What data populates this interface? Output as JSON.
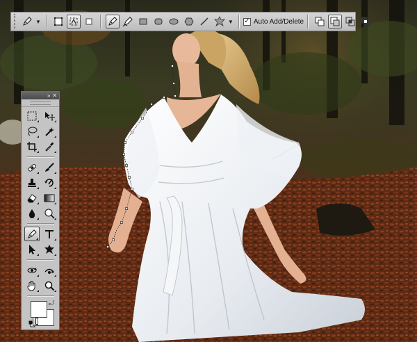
{
  "app": "Photoshop",
  "options_bar": {
    "tool_preset_icon": "pen-preset-icon",
    "mode_buttons": [
      "shape-layers-icon",
      "paths-icon",
      "fill-pixels-icon"
    ],
    "active_mode": "paths",
    "draw_tools": [
      "pen-icon",
      "freeform-pen-icon",
      "rectangle-icon",
      "rounded-rectangle-icon",
      "ellipse-icon",
      "polygon-icon",
      "line-icon",
      "custom-shape-icon"
    ],
    "active_draw_tool": "pen",
    "auto_add_delete": {
      "label": "Auto Add/Delete",
      "checked": true
    },
    "path_ops": [
      "add-to-path-area-icon",
      "subtract-from-path-area-icon",
      "intersect-path-areas-icon",
      "exclude-overlapping-path-areas-icon"
    ],
    "active_path_op": "subtract"
  },
  "tools_panel": {
    "collapse_glyph": "»",
    "close_glyph": "✕",
    "active_tool": "pen",
    "foreground_color": "#ffffff",
    "background_color": "#ffffff"
  },
  "colors": {
    "accent": "#444444",
    "panel_bg": "#c4c4c4"
  }
}
